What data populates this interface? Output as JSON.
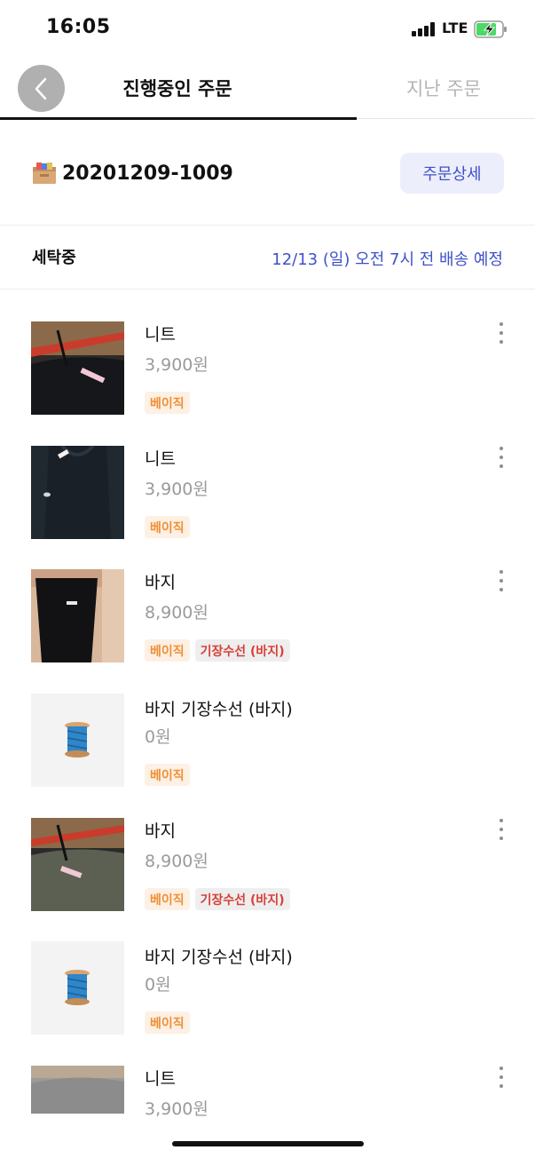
{
  "status_bar": {
    "time": "16:05",
    "network": "LTE"
  },
  "header": {
    "tab_active": "진행중인 주문",
    "tab_inactive": "지난 주문"
  },
  "order": {
    "number": "20201209-1009",
    "detail_button": "주문상세"
  },
  "status": {
    "label": "세탁중",
    "delivery": "12/13 (일) 오전 7시 전 배송 예정"
  },
  "items": [
    {
      "name": "니트",
      "price": "3,900원",
      "tags": [
        "베이직"
      ],
      "image": "black-knit-photo"
    },
    {
      "name": "니트",
      "price": "3,900원",
      "tags": [
        "베이직"
      ],
      "image": "black-knit-photo"
    },
    {
      "name": "바지",
      "price": "8,900원",
      "tags": [
        "베이직",
        "기장수선 (바지)"
      ],
      "image": "black-pants-photo"
    },
    {
      "name": "바지 기장수선 (바지)",
      "price": "0원",
      "tags": [
        "베이직"
      ],
      "image": "thread-spool-icon"
    },
    {
      "name": "바지",
      "price": "8,900원",
      "tags": [
        "베이직",
        "기장수선 (바지)"
      ],
      "image": "olive-pants-photo"
    },
    {
      "name": "바지 기장수선 (바지)",
      "price": "0원",
      "tags": [
        "베이직"
      ],
      "image": "thread-spool-icon"
    },
    {
      "name": "니트",
      "price": "3,900원",
      "tags": [],
      "image": "gray-knit-photo"
    }
  ],
  "colors": {
    "accent": "#3f51c8",
    "tag_basic": "#f09036",
    "tag_repair": "#d8413a"
  }
}
